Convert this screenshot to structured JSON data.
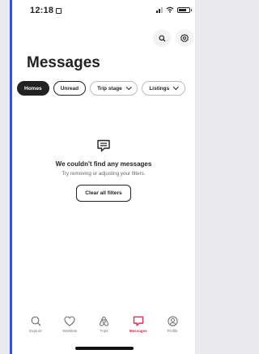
{
  "status_bar": {
    "time": "12:18"
  },
  "header": {
    "title": "Messages",
    "search_icon": "search-icon",
    "settings_icon": "settings-gear-icon"
  },
  "filters": [
    {
      "label": "Homes",
      "state": "selected"
    },
    {
      "label": "Unread",
      "state": "outlined"
    },
    {
      "label": "Trip stage",
      "state": "dropdown"
    },
    {
      "label": "Listings",
      "state": "dropdown"
    }
  ],
  "empty_state": {
    "icon": "message-bubble-icon",
    "title": "We couldn't find any messages",
    "subtitle": "Try removing or adjusting your filters.",
    "button": "Clear all filters"
  },
  "tab_bar": {
    "items": [
      {
        "label": "Explore",
        "icon": "search-icon"
      },
      {
        "label": "Wishlists",
        "icon": "heart-icon"
      },
      {
        "label": "Trips",
        "icon": "airbnb-logo-icon"
      },
      {
        "label": "Messages",
        "icon": "message-icon",
        "active": true
      },
      {
        "label": "Profile",
        "icon": "profile-icon"
      }
    ],
    "active_color": "#e0294e"
  }
}
